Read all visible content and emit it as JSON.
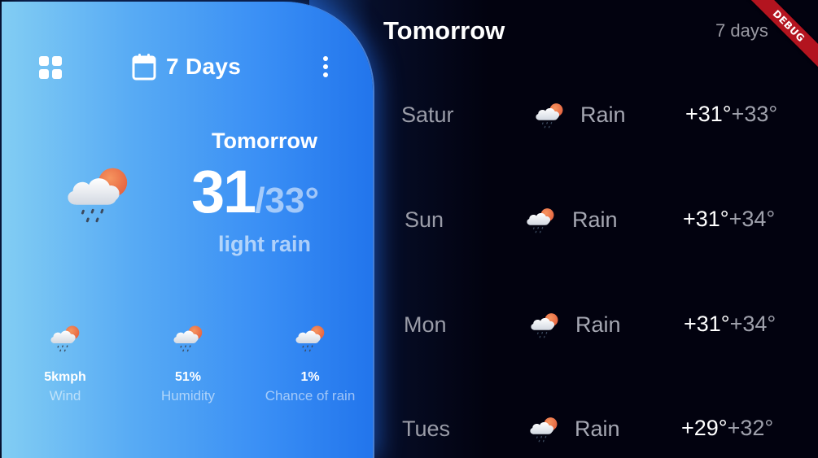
{
  "card": {
    "title": "7 Days",
    "tomorrow_label": "Tomorrow",
    "temp_high": "31",
    "temp_sep": "/33°",
    "condition": "light rain",
    "stats": [
      {
        "value": "5kmph",
        "label": "Wind",
        "icon": "rain-cloud-icon"
      },
      {
        "value": "51%",
        "label": "Humidity",
        "icon": "rain-cloud-icon"
      },
      {
        "value": "1%",
        "label": "Chance of rain",
        "icon": "rain-cloud-icon"
      }
    ],
    "icons": {
      "menu": "grid-icon",
      "calendar": "calendar-icon",
      "more": "more-vert-icon"
    }
  },
  "forecast": {
    "header": "Tomorrow",
    "subheader": "7 days",
    "days": [
      {
        "day": "Satur",
        "condition": "Rain",
        "high": "+31°",
        "low": "+33°"
      },
      {
        "day": "Sun",
        "condition": "Rain",
        "high": "+31°",
        "low": "+34°"
      },
      {
        "day": "Mon",
        "condition": "Rain",
        "high": "+31°",
        "low": "+34°"
      },
      {
        "day": "Tues",
        "condition": "Rain",
        "high": "+29°",
        "low": "+32°"
      }
    ]
  },
  "debug_banner": "DEBUG",
  "colors": {
    "card_start": "#82cdf3",
    "card_end": "#2275ec",
    "background": "#02020f",
    "ribbon": "#b3141f"
  }
}
